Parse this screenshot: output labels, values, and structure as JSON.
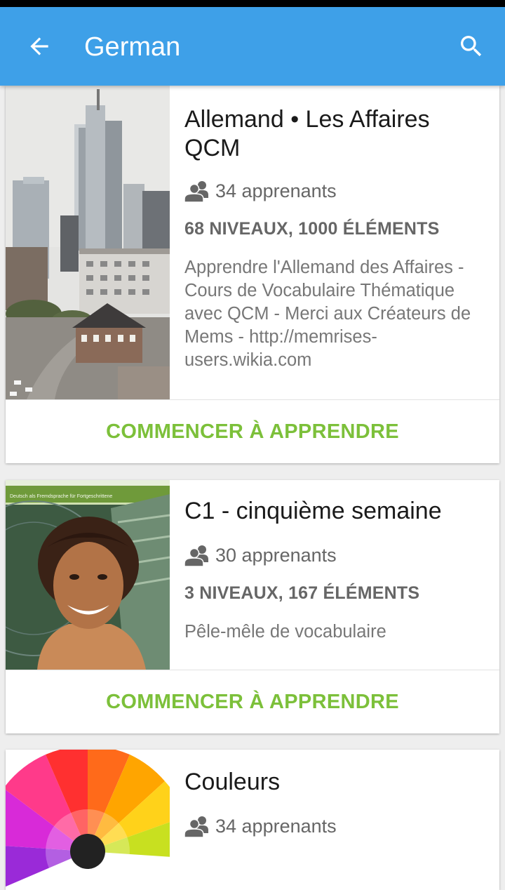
{
  "header": {
    "title": "German",
    "back_icon": "arrow-left-icon",
    "search_icon": "search-icon"
  },
  "colors": {
    "appbar": "#3ea0e8",
    "cta": "#7cc03a",
    "text_secondary": "#666666"
  },
  "courses": [
    {
      "title": "Allemand • Les Affaires QCM",
      "learners": "34 apprenants",
      "levels": "68 NIVEAUX, 1000 ÉLÉMENTS",
      "description": "Apprendre l'Allemand des Affaires - Cours de Vocabulaire Thématique avec QCM - Merci aux Créateurs de Mems -  http://memrises-users.wikia.com",
      "cta": "COMMENCER À APPRENDRE"
    },
    {
      "title": "C1 - cinquième semaine",
      "learners": "30 apprenants",
      "levels": "3 NIVEAUX, 167 ÉLÉMENTS",
      "description": "Pêle-mêle de vocabulaire",
      "cta": "COMMENCER À APPRENDRE",
      "thumb_text": "Deutsch als Fremdsprache für Fortgeschrittene"
    },
    {
      "title": "Couleurs",
      "learners": "34 apprenants"
    }
  ]
}
